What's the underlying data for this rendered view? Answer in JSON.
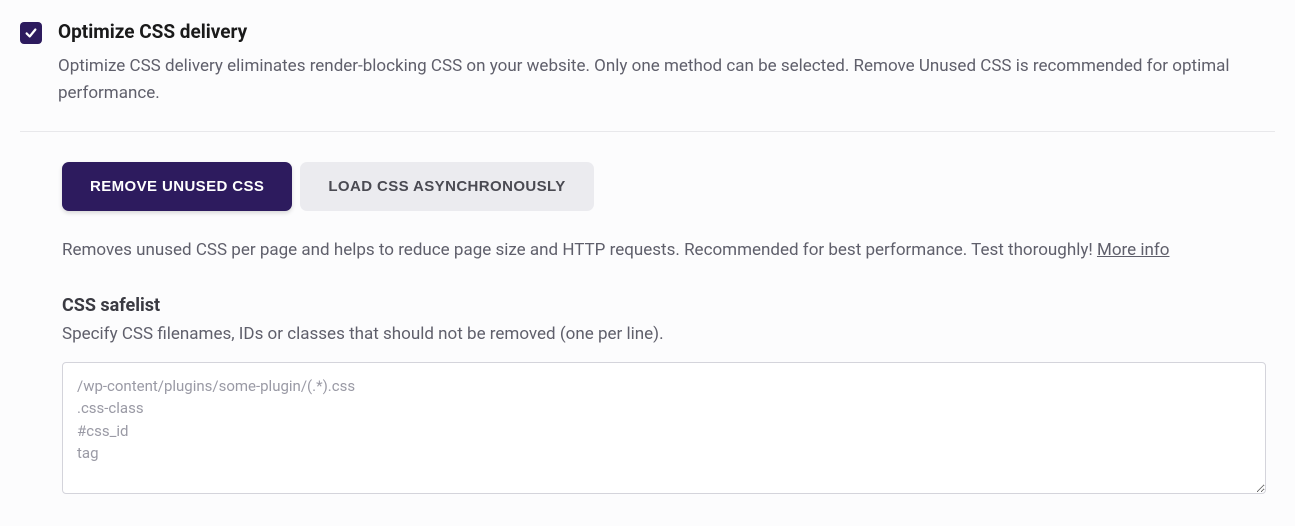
{
  "option": {
    "title": "Optimize CSS delivery",
    "description": "Optimize CSS delivery eliminates render-blocking CSS on your website. Only one method can be selected. Remove Unused CSS is recommended for optimal performance.",
    "checked": true
  },
  "tabs": {
    "active": "REMOVE UNUSED CSS",
    "inactive": "LOAD CSS ASYNCHRONOUSLY"
  },
  "subDescription": {
    "text": "Removes unused CSS per page and helps to reduce page size and HTTP requests. Recommended for best performance. Test thoroughly! ",
    "link": "More info"
  },
  "safelist": {
    "title": "CSS safelist",
    "description": "Specify CSS filenames, IDs or classes that should not be removed (one per line).",
    "placeholder": "/wp-content/plugins/some-plugin/(.*).css\n.css-class\n#css_id\ntag"
  }
}
